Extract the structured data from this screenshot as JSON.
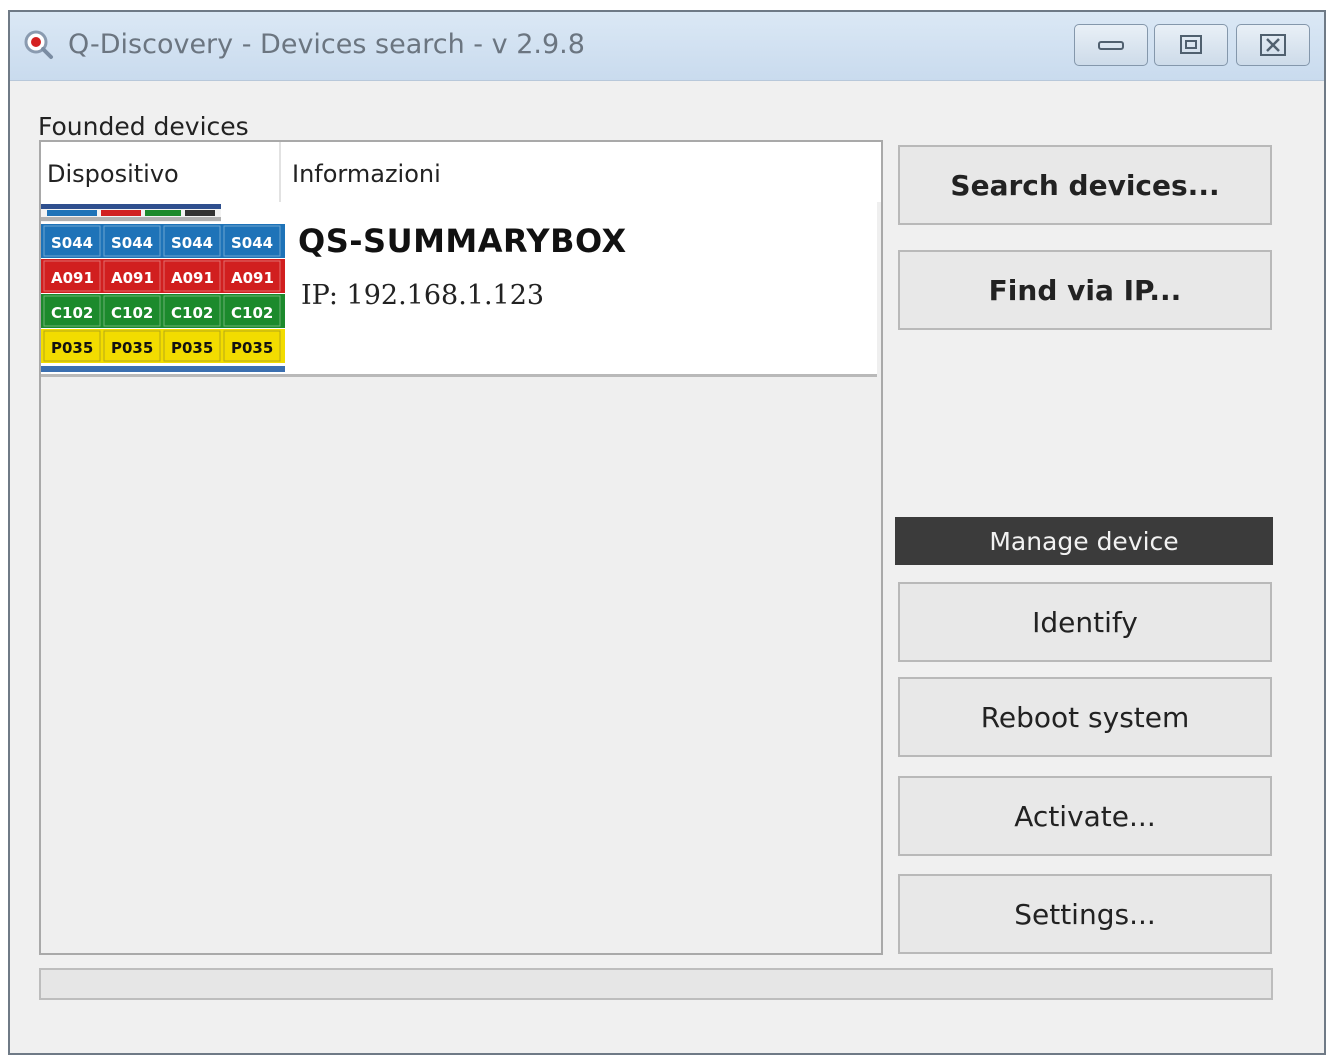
{
  "window": {
    "title": "Q-Discovery - Devices search - v 2.9.8",
    "controls": [
      "minimize-icon",
      "restore-icon",
      "close-icon"
    ]
  },
  "devices_group": {
    "label": "Founded devices",
    "columns": [
      "Dispositivo",
      "Informazioni"
    ],
    "rows": [
      {
        "thumbnail_icon": "summarybox-device-image",
        "thumbnail_rows": [
          {
            "color": "#1e73b8",
            "cells": [
              "S044",
              "S044",
              "S044",
              "S044"
            ]
          },
          {
            "color": "#d11f1f",
            "cells": [
              "A091",
              "A091",
              "A091",
              "A091"
            ]
          },
          {
            "color": "#1c8a2c",
            "cells": [
              "C102",
              "C102",
              "C102",
              "C102"
            ]
          },
          {
            "color": "#f2dc00",
            "cells": [
              "P035",
              "P035",
              "P035",
              "P035"
            ]
          }
        ],
        "name": "QS-SUMMARYBOX",
        "ip": "IP: 192.168.1.123"
      }
    ]
  },
  "actions": {
    "search": "Search devices...",
    "find_ip": "Find via IP..."
  },
  "manage": {
    "header": "Manage device",
    "identify": "Identify",
    "reboot": "Reboot system",
    "activate": "Activate...",
    "settings": "Settings..."
  },
  "progress": {
    "value": 0
  }
}
